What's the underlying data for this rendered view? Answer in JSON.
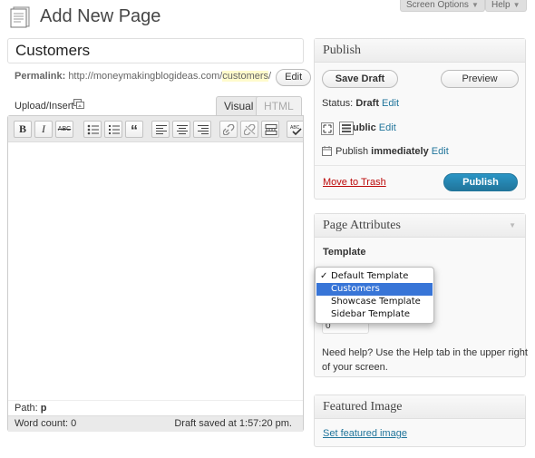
{
  "screen_options": {
    "label": "Screen Options",
    "arrow": "▼"
  },
  "help": {
    "label": "Help",
    "arrow": "▼"
  },
  "page_heading": "Add New Page",
  "title": {
    "value": "Customers"
  },
  "permalink": {
    "label": "Permalink:",
    "base_url": "http://moneymakingblogideas.com/",
    "slug": "customers",
    "trailing": "/",
    "edit_label": "Edit"
  },
  "editor": {
    "upload_insert_label": "Upload/Insert",
    "tab_visual": "Visual",
    "tab_html": "HTML",
    "toolbar": {
      "bold": "B",
      "italic": "I",
      "strike": "ABC",
      "quote": "“"
    },
    "path_label": "Path:",
    "path_value": "p",
    "word_count_label": "Word count:",
    "word_count": "0",
    "draft_saved": "Draft saved at 1:57:20 pm."
  },
  "publish_box": {
    "title": "Publish",
    "save_draft": "Save Draft",
    "preview": "Preview",
    "status_label": "Status:",
    "status_value": "Draft",
    "visibility_value": ": Public",
    "publish_label": "Publish",
    "publish_when": "immediately",
    "edit_label": "Edit",
    "move_to_trash": "Move to Trash",
    "publish_button": "Publish"
  },
  "page_attributes": {
    "title": "Page Attributes",
    "collapse_arrow": "▼",
    "template_label": "Template",
    "check_mark": "✓",
    "template_options": [
      "Default Template",
      "Customers",
      "Showcase Template",
      "Sidebar Template"
    ],
    "order_value": "0",
    "help_text_line1": "Need help? Use the Help tab in the upper right",
    "help_text_line2": "of your screen."
  },
  "featured_image": {
    "title": "Featured Image",
    "set_link": "Set featured image"
  },
  "colors": {
    "link": "#21759b",
    "primary": "#21759b",
    "trash": "#bc0b0b",
    "highlight": "#3875d7"
  }
}
